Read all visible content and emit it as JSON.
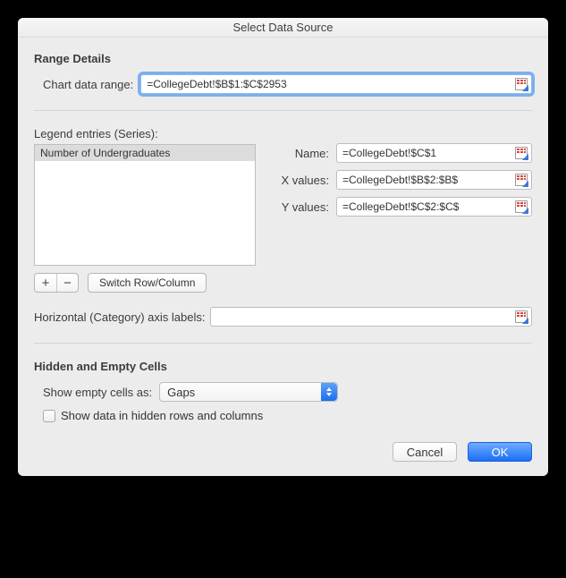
{
  "title": "Select Data Source",
  "range_details": {
    "heading": "Range Details",
    "chart_data_range_label": "Chart data range:",
    "chart_data_range_value": "=CollegeDebt!$B$1:$C$2953"
  },
  "legend": {
    "series_label": "Legend entries (Series):",
    "items": [
      "Number of Undergraduates"
    ],
    "name_label": "Name:",
    "name_value": "=CollegeDebt!$C$1",
    "x_label": "X values:",
    "x_value": "=CollegeDebt!$B$2:$B$",
    "y_label": "Y values:",
    "y_value": "=CollegeDebt!$C$2:$C$",
    "add_label": "+",
    "remove_label": "−",
    "switch_label": "Switch Row/Column"
  },
  "axis": {
    "label": "Horizontal (Category) axis labels:",
    "value": ""
  },
  "hidden": {
    "heading": "Hidden and Empty Cells",
    "show_empty_label": "Show empty cells as:",
    "show_empty_value": "Gaps",
    "show_hidden_label": "Show data in hidden rows and columns",
    "show_hidden_checked": false
  },
  "footer": {
    "cancel": "Cancel",
    "ok": "OK"
  }
}
